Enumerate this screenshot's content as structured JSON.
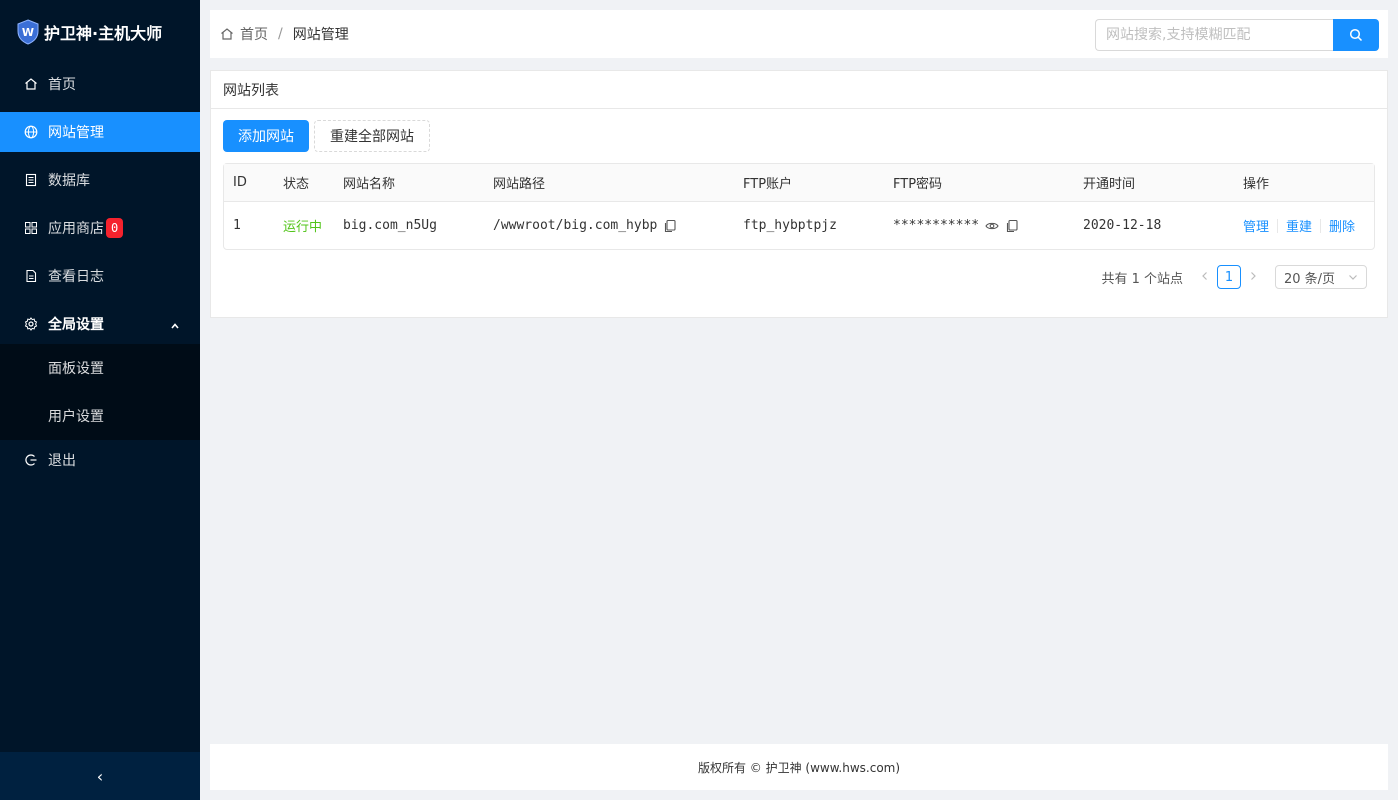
{
  "app": {
    "title": "护卫神·主机大师",
    "brand_color": "#1890ff",
    "sidebar_bg": "#001529"
  },
  "sidebar": {
    "items": [
      {
        "label": "首页",
        "icon": "home-icon"
      },
      {
        "label": "网站管理",
        "icon": "globe-icon",
        "active": true
      },
      {
        "label": "数据库",
        "icon": "database-icon"
      },
      {
        "label": "应用商店",
        "icon": "apps-icon",
        "badge": "0"
      },
      {
        "label": "查看日志",
        "icon": "log-icon"
      },
      {
        "label": "全局设置",
        "icon": "gear-icon",
        "expanded": true,
        "children": [
          {
            "label": "面板设置"
          },
          {
            "label": "用户设置"
          }
        ]
      },
      {
        "label": "退出",
        "icon": "logout-icon"
      }
    ],
    "collapse_symbol": "‹"
  },
  "header": {
    "breadcrumb": [
      "首页",
      "网站管理"
    ],
    "separator": "/",
    "search": {
      "placeholder": "网站搜索,支持模糊匹配",
      "value": ""
    }
  },
  "card": {
    "title": "网站列表",
    "buttons": {
      "add": "添加网站",
      "rebuild_all": "重建全部网站"
    },
    "table": {
      "headers": [
        "ID",
        "状态",
        "网站名称",
        "网站路径",
        "FTP账户",
        "FTP密码",
        "开通时间",
        "操作"
      ],
      "rows": [
        {
          "id": "1",
          "status": "运行中",
          "name": "big.com_n5Ug",
          "path": "/wwwroot/big.com_hybp",
          "ftp_user": "ftp_hybptpjz",
          "ftp_password": "***********",
          "created": "2020-12-18",
          "ops": [
            "管理",
            "重建",
            "删除"
          ]
        }
      ]
    },
    "pagination": {
      "total_text": "共有 1 个站点",
      "current_page": "1",
      "page_size": "20 条/页"
    }
  },
  "footer": {
    "text": "版权所有 © 护卫神 (www.hws.com)"
  }
}
